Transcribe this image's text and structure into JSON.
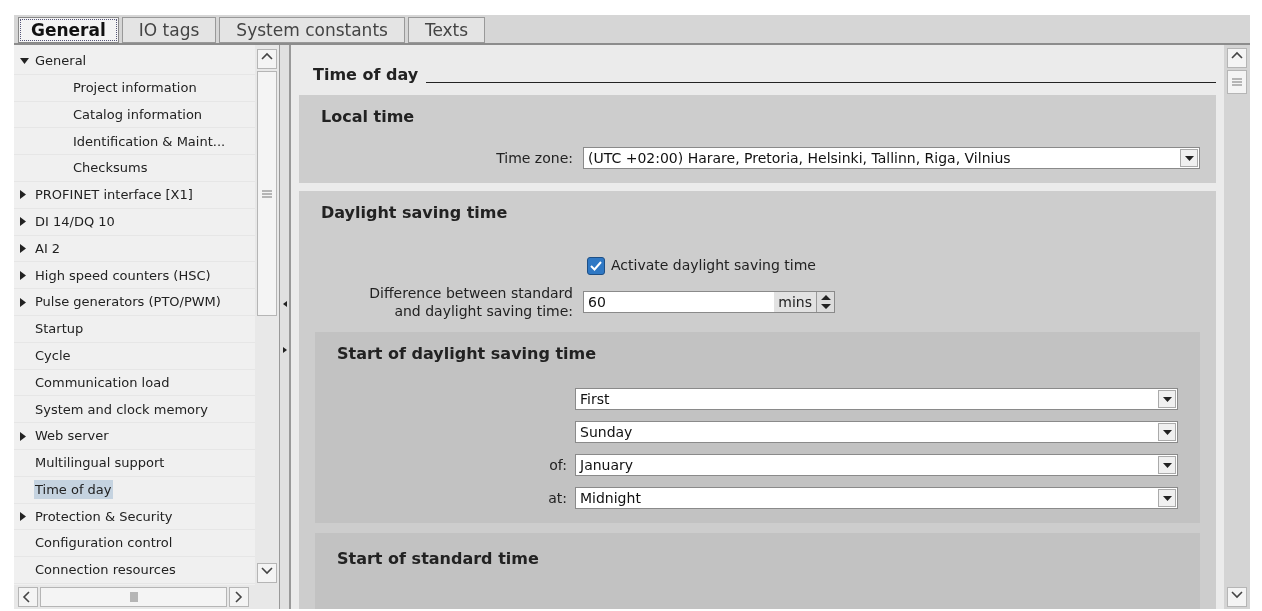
{
  "tabs": [
    {
      "label": "General",
      "selected": true
    },
    {
      "label": "IO tags",
      "selected": false
    },
    {
      "label": "System constants",
      "selected": false
    },
    {
      "label": "Texts",
      "selected": false
    }
  ],
  "tree": [
    {
      "label": "General",
      "expanded": true,
      "selected": false,
      "children": [
        {
          "label": "Project information",
          "selected": false
        },
        {
          "label": "Catalog information",
          "selected": false
        },
        {
          "label": "Identification & Maint...",
          "selected": false
        },
        {
          "label": "Checksums",
          "selected": false
        }
      ]
    },
    {
      "label": "PROFINET interface [X1]",
      "expanded": false,
      "selected": false
    },
    {
      "label": "DI 14/DQ 10",
      "expanded": false,
      "selected": false
    },
    {
      "label": "AI 2",
      "expanded": false,
      "selected": false
    },
    {
      "label": "High speed counters (HSC)",
      "expanded": false,
      "selected": false
    },
    {
      "label": "Pulse generators (PTO/PWM)",
      "expanded": false,
      "selected": false
    },
    {
      "label": "Startup",
      "selected": false
    },
    {
      "label": "Cycle",
      "selected": false
    },
    {
      "label": "Communication load",
      "selected": false
    },
    {
      "label": "System and clock memory",
      "selected": false
    },
    {
      "label": "Web server",
      "expanded": false,
      "selected": false
    },
    {
      "label": "Multilingual support",
      "selected": false
    },
    {
      "label": "Time of day",
      "selected": true
    },
    {
      "label": "Protection & Security",
      "expanded": false,
      "selected": false
    },
    {
      "label": "Configuration control",
      "selected": false
    },
    {
      "label": "Connection resources",
      "selected": false
    }
  ],
  "page": {
    "title": "Time of day",
    "local_time": {
      "title": "Local time",
      "time_zone_label": "Time zone:",
      "time_zone": "(UTC +02:00) Harare, Pretoria, Helsinki, Tallinn, Riga, Vilnius"
    },
    "daylight": {
      "title": "Daylight saving time",
      "activate": {
        "label": "Activate daylight saving time",
        "checked": true
      },
      "difference_label": [
        "Difference between standard",
        "and daylight saving time:"
      ],
      "difference": "60",
      "unit": "mins",
      "start": {
        "title": "Start of daylight saving time",
        "fields": [
          {
            "value": "First"
          },
          {
            "value": "Sunday"
          },
          {
            "label": "of:",
            "value": "January"
          },
          {
            "label": "at:",
            "value": "Midnight"
          }
        ]
      },
      "standard": {
        "title": "Start of standard time"
      }
    }
  }
}
